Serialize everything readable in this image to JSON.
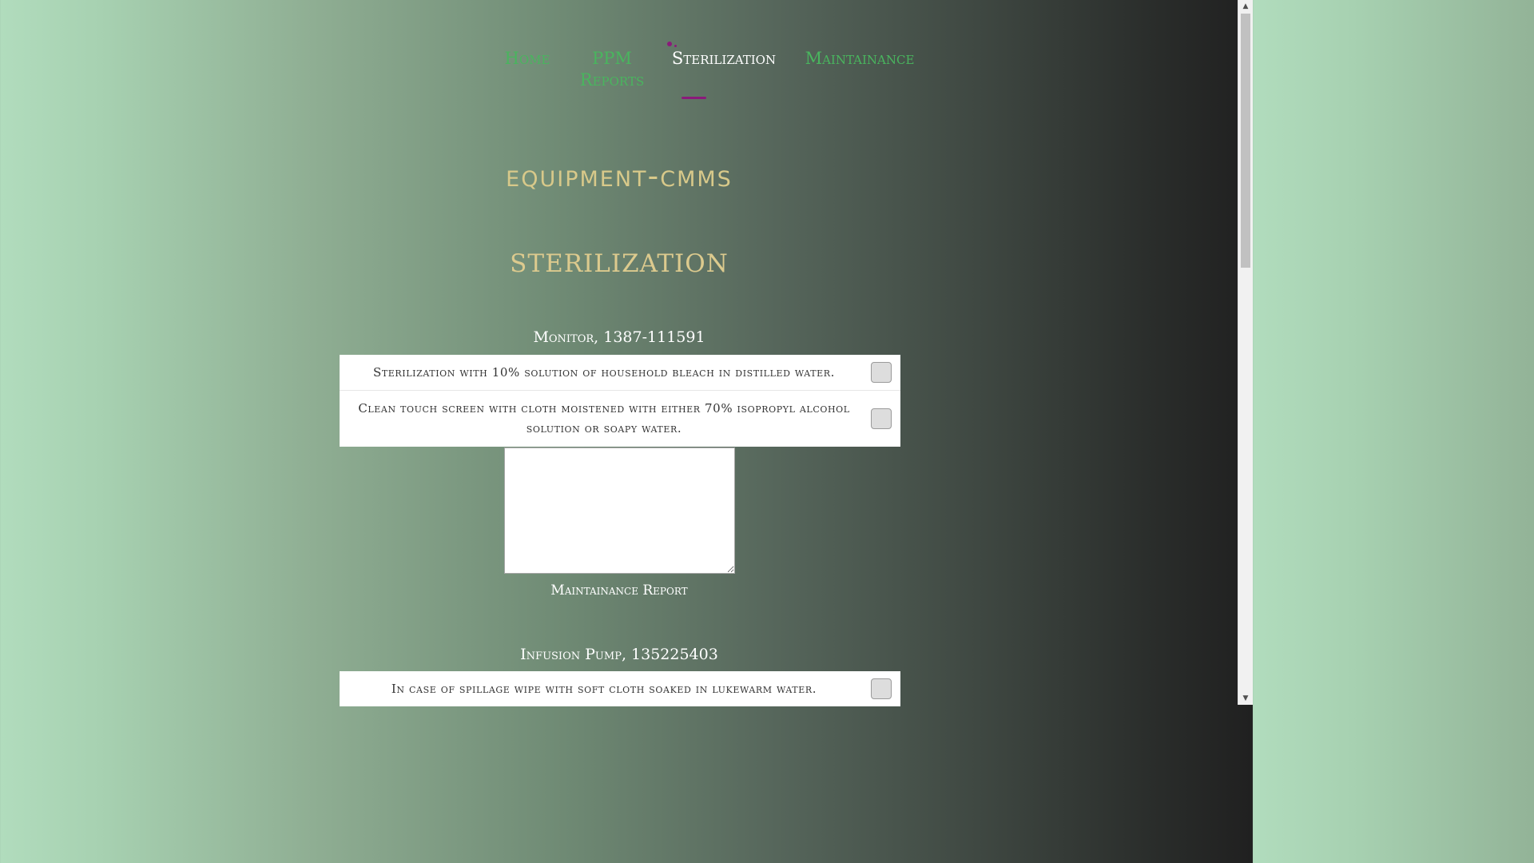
{
  "nav": {
    "items": [
      {
        "label": "Home",
        "active": false
      },
      {
        "label": "PPM Reports",
        "active": false
      },
      {
        "label": "Sterilization",
        "active": true
      },
      {
        "label": "Maintainance",
        "active": false
      }
    ]
  },
  "logo": "equipment-cmms",
  "page_title": "STERILIZATION",
  "devices": [
    {
      "title": "Monitor, 1387-111591",
      "tasks": [
        {
          "text": "Sterilization with 10% solution of household bleach in distilled water.",
          "checked": false
        },
        {
          "text": "Clean touch screen with cloth moistened with either 70% isopropyl alcohol solution or soapy water.",
          "checked": false
        }
      ],
      "report": {
        "value": "",
        "label": "Maintainance Report"
      }
    },
    {
      "title": "Infusion Pump, 135225403",
      "tasks": [
        {
          "text": "In case of spillage wipe with soft cloth soaked in lukewarm water.",
          "checked": false
        }
      ]
    }
  ],
  "colors": {
    "nav_link": "#49b55e",
    "nav_active": "#ffffff",
    "accent": "#8b1a7b",
    "title_gold": "#dcca8e"
  },
  "scrollbar": {
    "up_icon": "▲",
    "down_icon": "▼"
  }
}
